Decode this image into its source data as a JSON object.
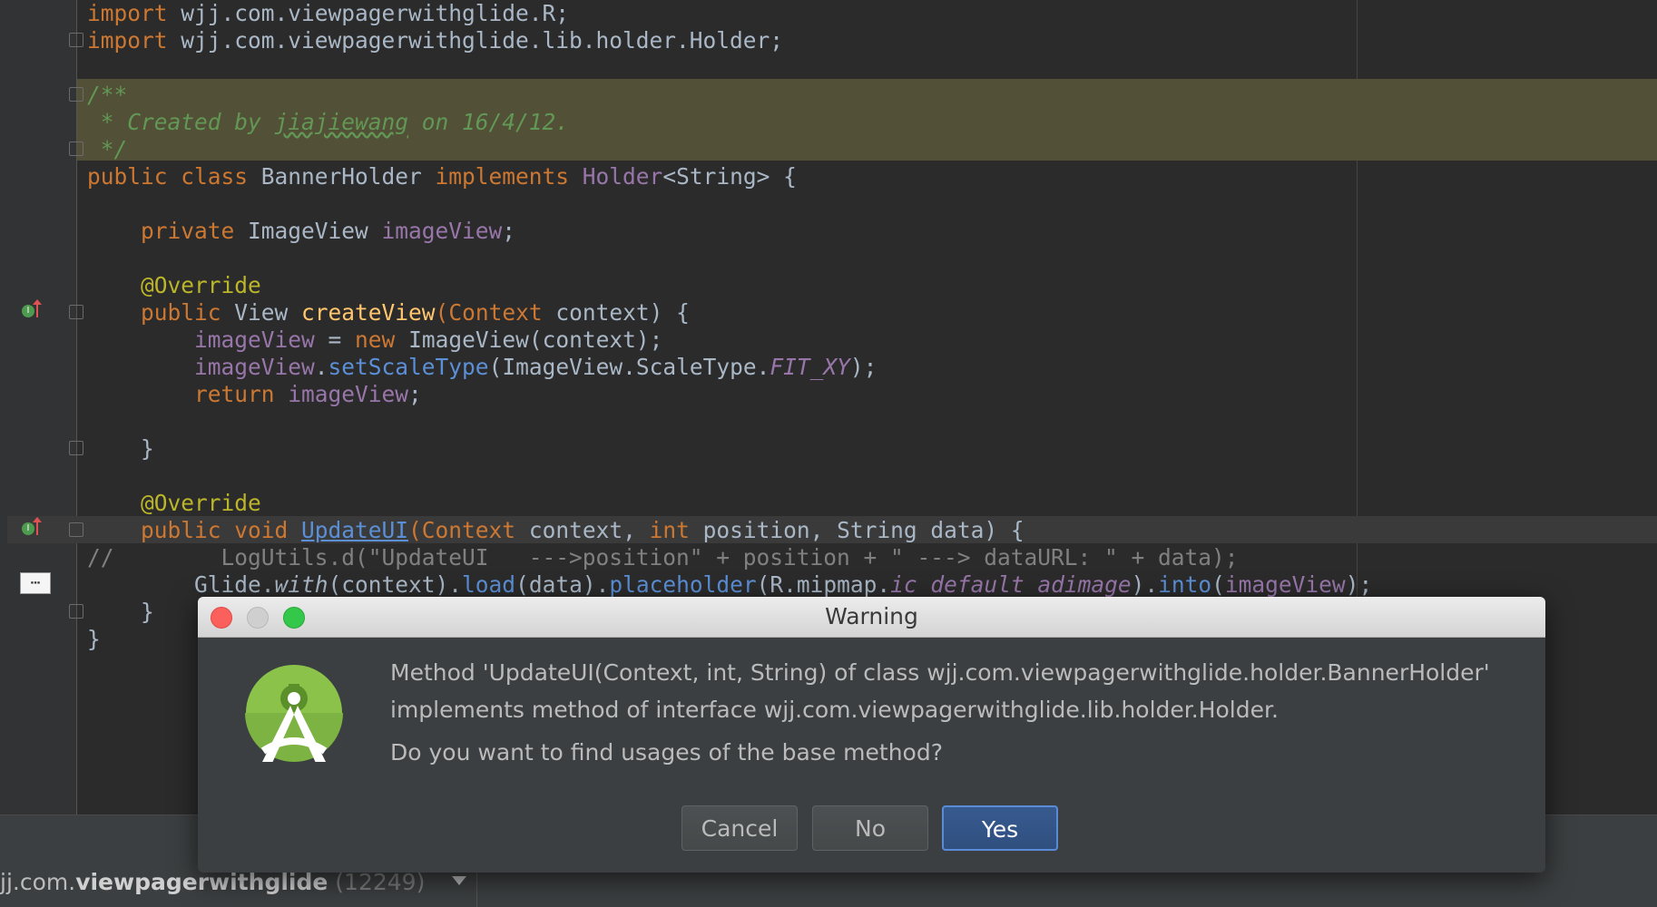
{
  "editor": {
    "lines": {
      "l1": {
        "kw": "import",
        "rest": " wjj.com.viewpagerwithglide.R;"
      },
      "l2": {
        "kw": "import",
        "rest": " wjj.com.viewpagerwithglide.lib.holder.Holder;"
      },
      "l4": "/**",
      "l5a": " * Created by ",
      "l5b": "jiajiewang",
      "l5c": " on 16/4/12.",
      "l6": " */",
      "l7": {
        "a": "public class ",
        "b": "BannerHolder ",
        "c": "implements ",
        "d": "Holder",
        "e": "<String> {"
      },
      "l9": {
        "a": "    private ",
        "b": "ImageView ",
        "c": "imageView",
        "d": ";"
      },
      "l11": "    @Override",
      "l12": {
        "a": "    public ",
        "b": "View ",
        "c": "createView",
        "d": "(",
        "e": "Context ",
        "f": "context) {"
      },
      "l13": {
        "a": "        ",
        "b": "imageView",
        "c": " = ",
        "d": "new ",
        "e": "ImageView(context);"
      },
      "l14": {
        "a": "        ",
        "b": "imageView",
        "c": ".",
        "d": "setScaleType",
        "e": "(ImageView.ScaleType.",
        "f": "FIT_XY",
        "g": ");"
      },
      "l15": {
        "a": "        return ",
        "b": "imageView",
        "c": ";"
      },
      "l17": "    }",
      "l19": "    @Override",
      "l20": {
        "a": "    public void ",
        "b": "UpdateUI",
        "c": "(",
        "d": "Context ",
        "e": "context, ",
        "f": "int ",
        "g": "position, ",
        "h": "String ",
        "i": "data) {"
      },
      "l21": "//        LogUtils.d(\"UpdateUI   --->position\" + position + \" ---> dataURL: \" + data);",
      "l22": {
        "a": "        Glide.",
        "b": "with",
        "c": "(context).",
        "d": "load",
        "e": "(data).",
        "f": "placeholder",
        "g": "(R.mipmap.",
        "h": "ic_default_adimage",
        "i": ").",
        "j": "into",
        "k": "(",
        "l": "imageView",
        "m": ");"
      },
      "l23": "    }",
      "l24": "}"
    }
  },
  "bottom": {
    "process_prefix": "jj.com.",
    "process_bold": "viewpagerwithglide",
    "process_pid": " (12249)"
  },
  "dialog": {
    "title": "Warning",
    "message_line1": "Method 'UpdateUI(Context, int, String) of class wjj.com.viewpagerwithglide.holder.BannerHolder'",
    "message_line2": "implements method of interface wjj.com.viewpagerwithglide.lib.holder.Holder.",
    "message_line3": "Do you want to find usages of the base method?",
    "cancel_label": "Cancel",
    "no_label": "No",
    "yes_label": "Yes"
  },
  "colors": {
    "keyword": "#cc7832",
    "field": "#9876aa",
    "annotation": "#bbb529",
    "method_decl": "#ffc66d",
    "doc_comment": "#629755",
    "primary_button": "#2f4f7f"
  }
}
